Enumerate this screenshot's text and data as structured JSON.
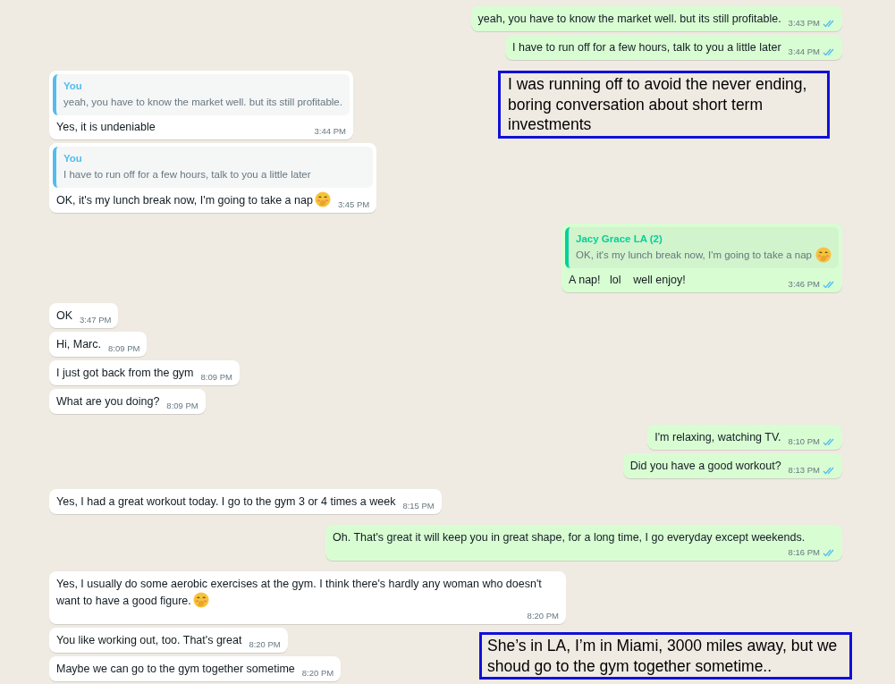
{
  "messages": [
    {
      "kind": "outgoing",
      "text": "yeah, you have to know the market well. but its still profitable.",
      "time": "3:43 PM",
      "read": true
    },
    {
      "kind": "outgoing",
      "text": "I have to run off for a few hours, talk to you a little later",
      "time": "3:44 PM",
      "read": true
    },
    {
      "kind": "incoming",
      "quote": {
        "author": "You",
        "text": "yeah, you have to know the market well. but its still profitable."
      },
      "text": "Yes, it is undeniable",
      "time": "3:44 PM"
    },
    {
      "kind": "incoming",
      "quote": {
        "author": "You",
        "text": "I have to run off for a few hours, talk to you a little later"
      },
      "text": "OK, it's my lunch break now, I'm going to take a nap",
      "emoji": true,
      "time": "3:45 PM"
    },
    {
      "kind": "outgoing",
      "quote": {
        "author": "Jacy Grace LA (2)",
        "text": "OK, it's my lunch break now, I'm going to take a nap",
        "emoji": true
      },
      "text": "A nap!   lol    well enjoy!",
      "time": "3:46 PM",
      "read": true
    },
    {
      "kind": "incoming",
      "text": "OK",
      "time": "3:47 PM"
    },
    {
      "kind": "incoming",
      "text": "Hi, Marc.",
      "time": "8:09 PM"
    },
    {
      "kind": "incoming",
      "text": "I just got back from the gym",
      "time": "8:09 PM"
    },
    {
      "kind": "incoming",
      "text": "What are you doing?",
      "time": "8:09 PM"
    },
    {
      "kind": "outgoing",
      "text": "I'm relaxing, watching TV.",
      "time": "8:10 PM",
      "read": true
    },
    {
      "kind": "outgoing",
      "text": "Did you have a good workout?",
      "time": "8:13 PM",
      "read": true
    },
    {
      "kind": "incoming",
      "text": "Yes, I had a great workout today. I go to the gym 3 or 4 times a week",
      "time": "8:15 PM"
    },
    {
      "kind": "outgoing",
      "text": "Oh. That's great it will keep you in great shape, for a long time, I go everyday except weekends.",
      "time": "8:16 PM",
      "read": true
    },
    {
      "kind": "incoming",
      "text": "Yes, I usually do some aerobic exercises at the gym. I think there's hardly any woman who doesn't want to have a good figure.",
      "emoji": true,
      "time": "8:20 PM"
    },
    {
      "kind": "incoming",
      "text": "You like working out, too. That's great",
      "time": "8:20 PM"
    },
    {
      "kind": "incoming",
      "text": "Maybe we can go to the gym together sometime",
      "time": "8:20 PM"
    }
  ],
  "annotations": [
    {
      "text": "I was running off to avoid the never ending, boring conversation about short term investments"
    },
    {
      "text": "She’s in LA, I’m in Miami, 3000 miles away, but we shoud go to the gym together sometime.."
    }
  ]
}
